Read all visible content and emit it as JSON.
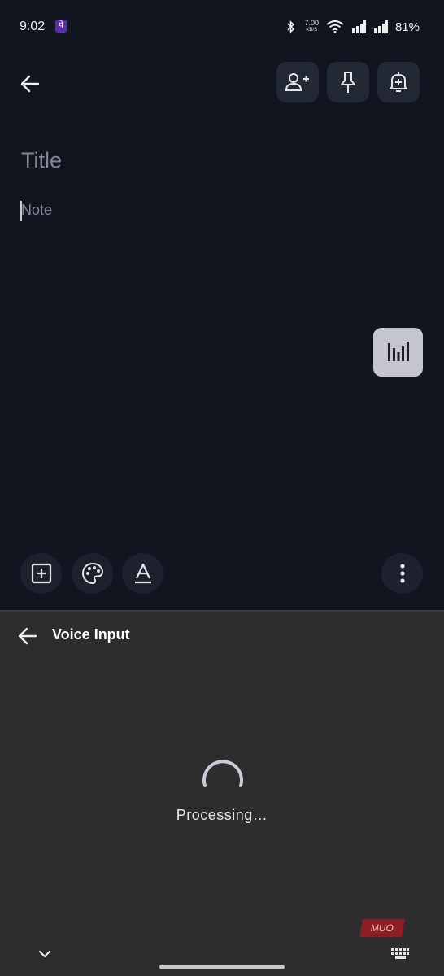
{
  "status_bar": {
    "time": "9:02",
    "app_badge": "पे",
    "speed_value": "7.00",
    "speed_unit": "KB/S",
    "battery": "81%"
  },
  "toolbar": {
    "back_icon": "arrow-left-icon",
    "actions": [
      "add-collaborator-icon",
      "pin-icon",
      "add-reminder-icon"
    ]
  },
  "editor": {
    "title_placeholder": "Title",
    "note_placeholder": "Note"
  },
  "fab": {
    "icon": "audio-waveform-icon"
  },
  "bottom_tools": [
    "add-box-icon",
    "palette-icon",
    "text-format-icon",
    "more-vert-icon"
  ],
  "voice_input": {
    "title": "Voice Input",
    "status": "Processing…",
    "watermark": "MUO"
  },
  "colors": {
    "background": "#111520",
    "panel": "#2d2d2e",
    "button": "#232835",
    "fab": "#c4c5cf"
  }
}
